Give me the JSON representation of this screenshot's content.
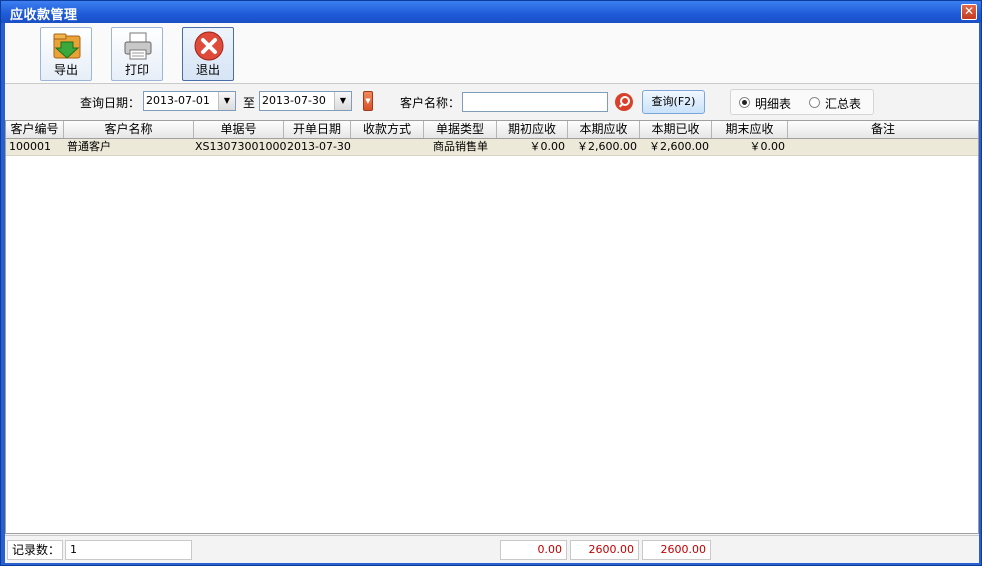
{
  "window": {
    "title": "应收款管理",
    "close_glyph": "✕"
  },
  "toolbar": {
    "export_label": "导出",
    "print_label": "打印",
    "exit_label": "退出"
  },
  "filter": {
    "date_label": "查询日期：",
    "date_from": "2013-07-01",
    "to_label": "至",
    "date_to": "2013-07-30",
    "customer_label": "客户名称：",
    "customer_value": "",
    "query_button": "查询(F2)",
    "mode_detail": "明细表",
    "mode_summary": "汇总表",
    "selected_mode": "明细表"
  },
  "table": {
    "columns": [
      "客户编号",
      "客户名称",
      "单据号",
      "开单日期",
      "收款方式",
      "单据类型",
      "期初应收",
      "本期应收",
      "本期已收",
      "期末应收",
      "备注"
    ],
    "rows": [
      [
        "100001",
        "普通客户",
        "XS130730010001",
        "2013-07-30",
        "",
        "商品销售单",
        "￥0.00",
        "￥2,600.00",
        "￥2,600.00",
        "￥0.00",
        ""
      ]
    ]
  },
  "footer": {
    "count_label": "记录数：",
    "count_value": "1",
    "total_opening": "0.00",
    "total_current": "2600.00",
    "total_received": "2600.00"
  },
  "colors": {
    "title_bar": "#1e5ad8",
    "selected_row": "#ece9d8",
    "total_text": "#c00000"
  }
}
